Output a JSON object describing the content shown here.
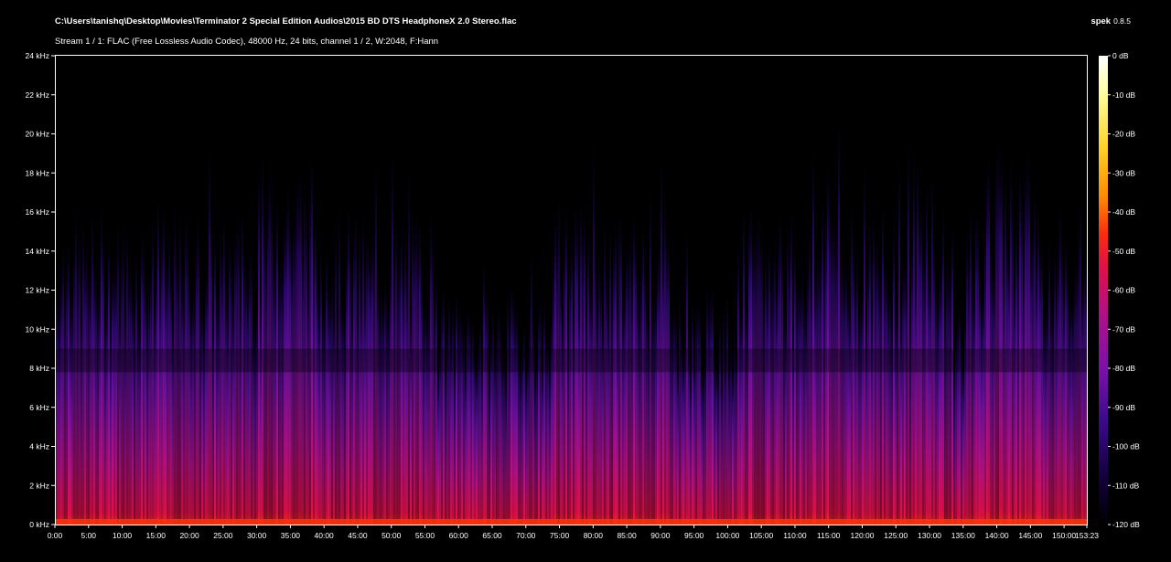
{
  "header": {
    "file_path": "C:\\Users\\tanishq\\Desktop\\Movies\\Terminator 2 Special Edition Audios\\2015 BD DTS HeadphoneX 2.0 Stereo.flac",
    "stream_info": "Stream 1 / 1: FLAC (Free Lossless Audio Codec), 48000 Hz, 24 bits, channel 1 / 2, W:2048, F:Hann",
    "app_name": "spek",
    "app_version": "0.8.5"
  },
  "chart_data": {
    "type": "heatmap",
    "title": "",
    "xlabel": "",
    "ylabel": "",
    "x_range_minutes": [
      0,
      153.3833
    ],
    "y_range_khz": [
      0,
      24
    ],
    "x_ticks": [
      "0:00",
      "5:00",
      "10:00",
      "15:00",
      "20:00",
      "25:00",
      "30:00",
      "35:00",
      "40:00",
      "45:00",
      "50:00",
      "55:00",
      "60:00",
      "65:00",
      "70:00",
      "75:00",
      "80:00",
      "85:00",
      "90:00",
      "95:00",
      "100:00",
      "105:00",
      "110:00",
      "115:00",
      "120:00",
      "125:00",
      "130:00",
      "135:00",
      "140:00",
      "145:00",
      "150:00",
      "153:23"
    ],
    "y_ticks": [
      "0 kHz",
      "2 kHz",
      "4 kHz",
      "6 kHz",
      "8 kHz",
      "10 kHz",
      "12 kHz",
      "14 kHz",
      "16 kHz",
      "18 kHz",
      "20 kHz",
      "22 kHz",
      "24 kHz"
    ],
    "colorbar_range_db": [
      -120,
      0
    ],
    "colorbar_ticks": [
      "0 dB",
      "-10 dB",
      "-20 dB",
      "-30 dB",
      "-40 dB",
      "-50 dB",
      "-60 dB",
      "-70 dB",
      "-80 dB",
      "-90 dB",
      "-100 dB",
      "-110 dB",
      "-120 dB"
    ],
    "colormap": [
      "#000000",
      "#12003a",
      "#3a0a8a",
      "#7a10a8",
      "#b0108a",
      "#e01048",
      "#ff2a10",
      "#ff8a00",
      "#ffd020",
      "#ffffa0",
      "#ffffff"
    ]
  }
}
